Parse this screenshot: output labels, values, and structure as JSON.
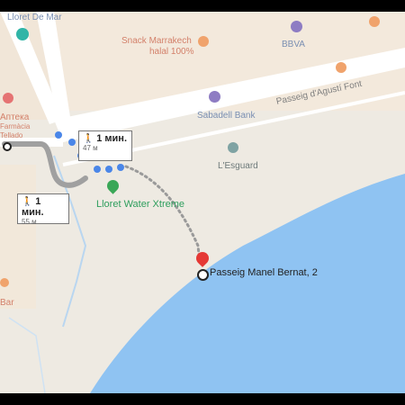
{
  "map": {
    "labels": {
      "lloret_de_mar": "Lloret De Mar",
      "snack": "Snack Marrakech",
      "halal": "halal 100%",
      "bbva": "BBVA",
      "apteka": "Аптека",
      "farmacia": "Farmàcia",
      "tellado": "Tellado",
      "sabadell": "Sabadell Bank",
      "esguard": "L'Esguard",
      "water_xtreme": "Lloret Water Xtreme",
      "bar": "Bar",
      "street": "Passeig d'Agustí Font"
    },
    "route": {
      "walk1_time": "1 мин.",
      "walk1_dist": "47 м",
      "walk2_time": "1 мин.",
      "walk2_dist": "55 м"
    },
    "destination": {
      "name": "Passeig Manel Bernat, 2"
    },
    "colors": {
      "sea": "#8fc3f2",
      "land": "#eeeae2",
      "road": "#ffffff",
      "route_blue": "#4a86e8",
      "route_gray": "#a0a0a0",
      "marker_red": "#e53935"
    }
  }
}
